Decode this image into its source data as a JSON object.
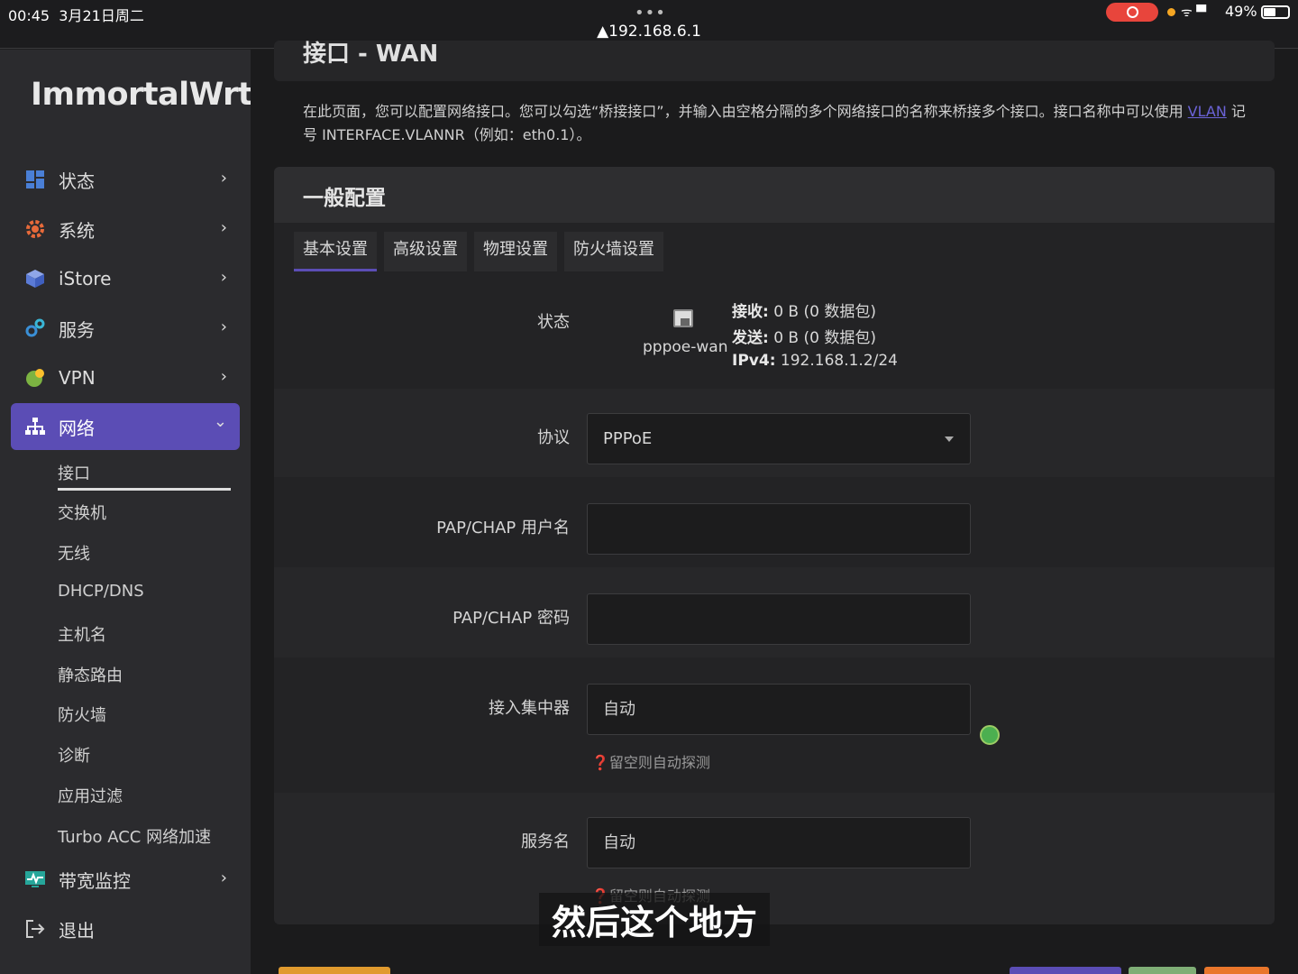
{
  "statusbar": {
    "time": "00:45",
    "date": "3月21日周二",
    "dots": "•••",
    "url": "▲192.168.6.1",
    "battery": "49%",
    "signal_icons": "ᯤ ▀"
  },
  "brand": {
    "logo": "ImmortalWrt"
  },
  "menu": [
    {
      "label": "状态",
      "icon": "dashboard-icon",
      "arrow": "›"
    },
    {
      "label": "系统",
      "icon": "gear-icon",
      "arrow": "›"
    },
    {
      "label": "iStore",
      "icon": "cube-icon",
      "arrow": "›"
    },
    {
      "label": "服务",
      "icon": "cogs-icon",
      "arrow": "›"
    },
    {
      "label": "VPN",
      "icon": "globe-icon",
      "arrow": "›"
    },
    {
      "label": "网络",
      "icon": "sitemap-icon",
      "arrow": "⌄"
    }
  ],
  "submenu": [
    "接口",
    "交换机",
    "无线",
    "DHCP/DNS",
    "主机名",
    "静态路由",
    "防火墙",
    "诊断",
    "应用过滤",
    "Turbo ACC 网络加速"
  ],
  "menu_bottom": [
    {
      "label": "带宽监控",
      "icon": "monitor-icon",
      "arrow": "›"
    },
    {
      "label": "退出",
      "icon": "logout-icon"
    }
  ],
  "page": {
    "title": "接口 - WAN",
    "desc_before": "在此页面，您可以配置网络接口。您可以勾选“桥接接口”，并输入由空格分隔的多个网络接口的名称来桥接多个接口。接口名称中可以使用 ",
    "desc_link": "VLAN",
    "desc_after": " 记号 INTERFACE.VLANNR（例如：eth0.1）。"
  },
  "section": {
    "title": "一般配置",
    "tabs": [
      "基本设置",
      "高级设置",
      "物理设置",
      "防火墙设置"
    ]
  },
  "status": {
    "label": "状态",
    "iface": "pppoe-wan",
    "rx_label": "接收:",
    "rx_value": " 0 B (0 数据包)",
    "tx_label": "发送:",
    "tx_value": " 0 B (0 数据包)",
    "ip_label": "IPv4:",
    "ip_value": " 192.168.1.2/24"
  },
  "form": {
    "protocol": {
      "label": "协议",
      "value": "PPPoE"
    },
    "username": {
      "label": "PAP/CHAP 用户名",
      "value": ""
    },
    "password": {
      "label": "PAP/CHAP 密码",
      "value": ""
    },
    "concentrator": {
      "label": "接入集中器",
      "placeholder": "自动",
      "hint": "❓留空则自动探测"
    },
    "service": {
      "label": "服务名",
      "placeholder": "自动",
      "hint": "❓留空则自动探测"
    }
  },
  "subtitle": "然后这个地方",
  "colors": {
    "accent": "#5b4db5",
    "bg": "#1b1b1c",
    "sidebar": "#2b2b2e",
    "save": "#e09a2e",
    "apply": "#5b4db5",
    "reset": "#7fae76",
    "orange": "#e9762b"
  }
}
